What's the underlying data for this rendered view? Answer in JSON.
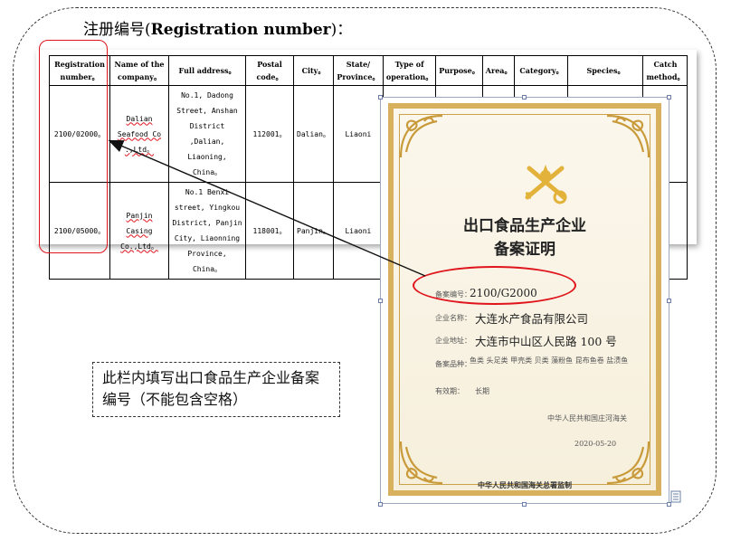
{
  "title": {
    "prefix": "注册编号(",
    "bold": "Registration number",
    "suffix": ")："
  },
  "table": {
    "headers": [
      "Registration number。",
      "Name of the company。",
      "Full address。",
      "Postal code。",
      "City。",
      "State/ Province。",
      "Type of operation。",
      "Purpose。",
      "Area。",
      "Category。",
      "Species。",
      "Catch method。"
    ],
    "rows": [
      {
        "registration": "2100/02000。",
        "company": "Dalian Seafood Co .,Ltd。",
        "address": "No.1, Dadong Street, Anshan District ,Dalian, Liaoning, China。",
        "postal": "112001。",
        "city": "Dalian。",
        "province": "Liaoni"
      },
      {
        "registration": "2100/05000。",
        "company": "Panjin Casing Co.,Ltd。",
        "address": "No.1 Benxi street, Yingkou District, Panjin City, Liaonning Province, China。",
        "postal": "118001。",
        "city": "Panjin。",
        "province": "Liaoni"
      }
    ]
  },
  "certificate": {
    "title_line1": "出口食品生产企业",
    "title_line2": "备案证明",
    "fields": [
      {
        "label": "备案编号：",
        "value": "2100/G2000"
      },
      {
        "label": "企业名称：",
        "value": "大连水产食品有限公司"
      },
      {
        "label": "企业地址：",
        "value": "大连市中山区人民路 100 号"
      },
      {
        "label": "备案品种：",
        "value": "鱼类 头足类 甲壳类 贝类 藻粉鱼 昆布鱼卷 盐渍鱼"
      },
      {
        "label": "有效期：",
        "value": "长期"
      }
    ],
    "issuer": "中华人民共和国庄河海关",
    "date": "2020-05-20",
    "footer": "中华人民共和国海关总署监制"
  },
  "note": {
    "text": "此栏内填写出口食品生产企业备案编号（不能包含空格）"
  },
  "colors": {
    "highlight": "#e0141c",
    "gold": "#d7b15e"
  }
}
